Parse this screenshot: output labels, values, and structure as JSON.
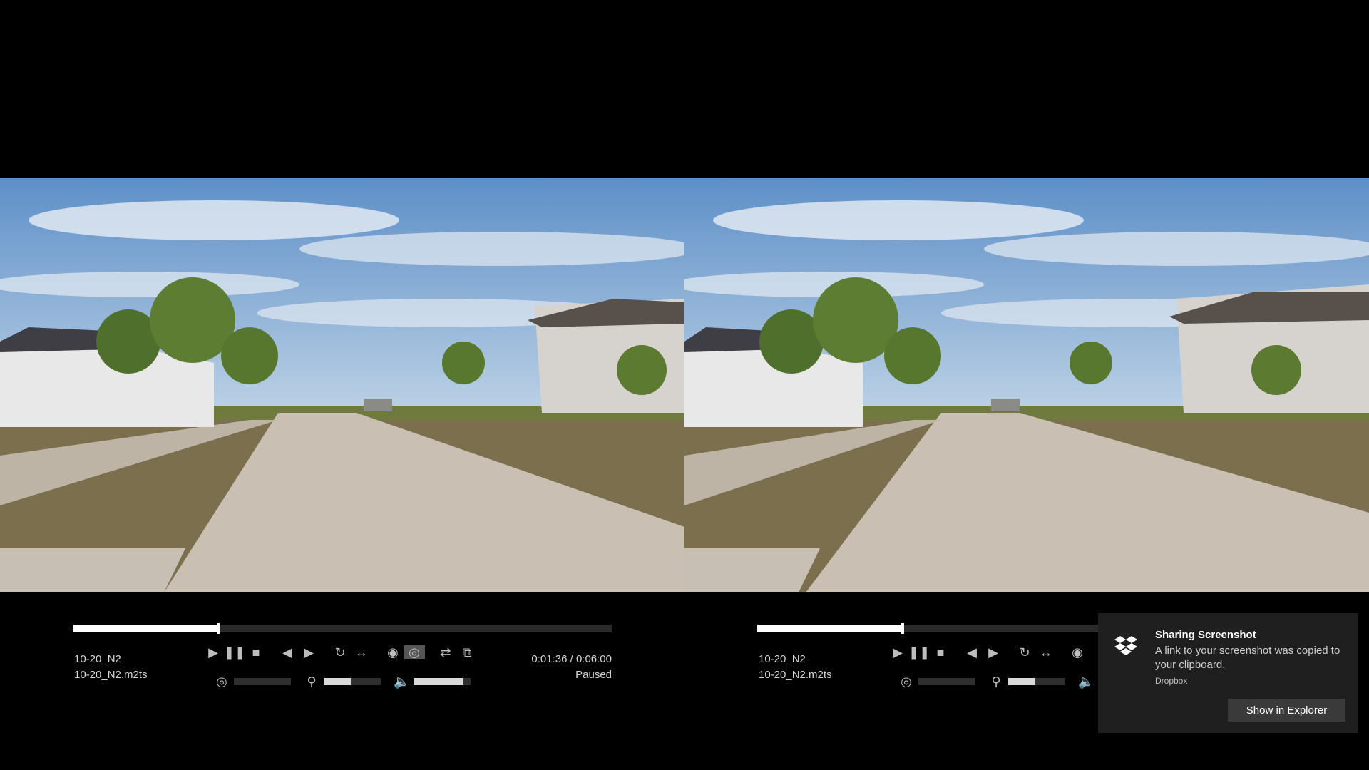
{
  "player": {
    "progress": 0.27,
    "file_title": "10-20_N2",
    "file_name": "10-20_N2.m2ts",
    "time": "0:01:36 / 0:06:00",
    "status": "Paused",
    "buttons": [
      "play-icon",
      "pause-icon",
      "stop-icon",
      "previous-icon",
      "next-icon",
      "repeat-icon",
      "ab-loop-icon",
      "view-mode-icon",
      "glasses-3d-icon",
      "swap-lr-icon",
      "fullscreen-icon"
    ],
    "sliders": [
      {
        "icon": "parallax-icon",
        "level": 0.0
      },
      {
        "icon": "zoom-icon",
        "level": 0.48
      },
      {
        "icon": "volume-icon",
        "level": 0.88
      }
    ]
  },
  "notification": {
    "title": "Sharing Screenshot",
    "message": "A link to your screenshot was copied to your clipboard.",
    "source": "Dropbox",
    "button_label": "Show in Explorer",
    "logo_icon": "dropbox-logo-icon"
  },
  "colors": {
    "sky": "#6f97c6",
    "road": "#c8beb2",
    "grass": "#6f7a3e",
    "background": "#000000"
  }
}
